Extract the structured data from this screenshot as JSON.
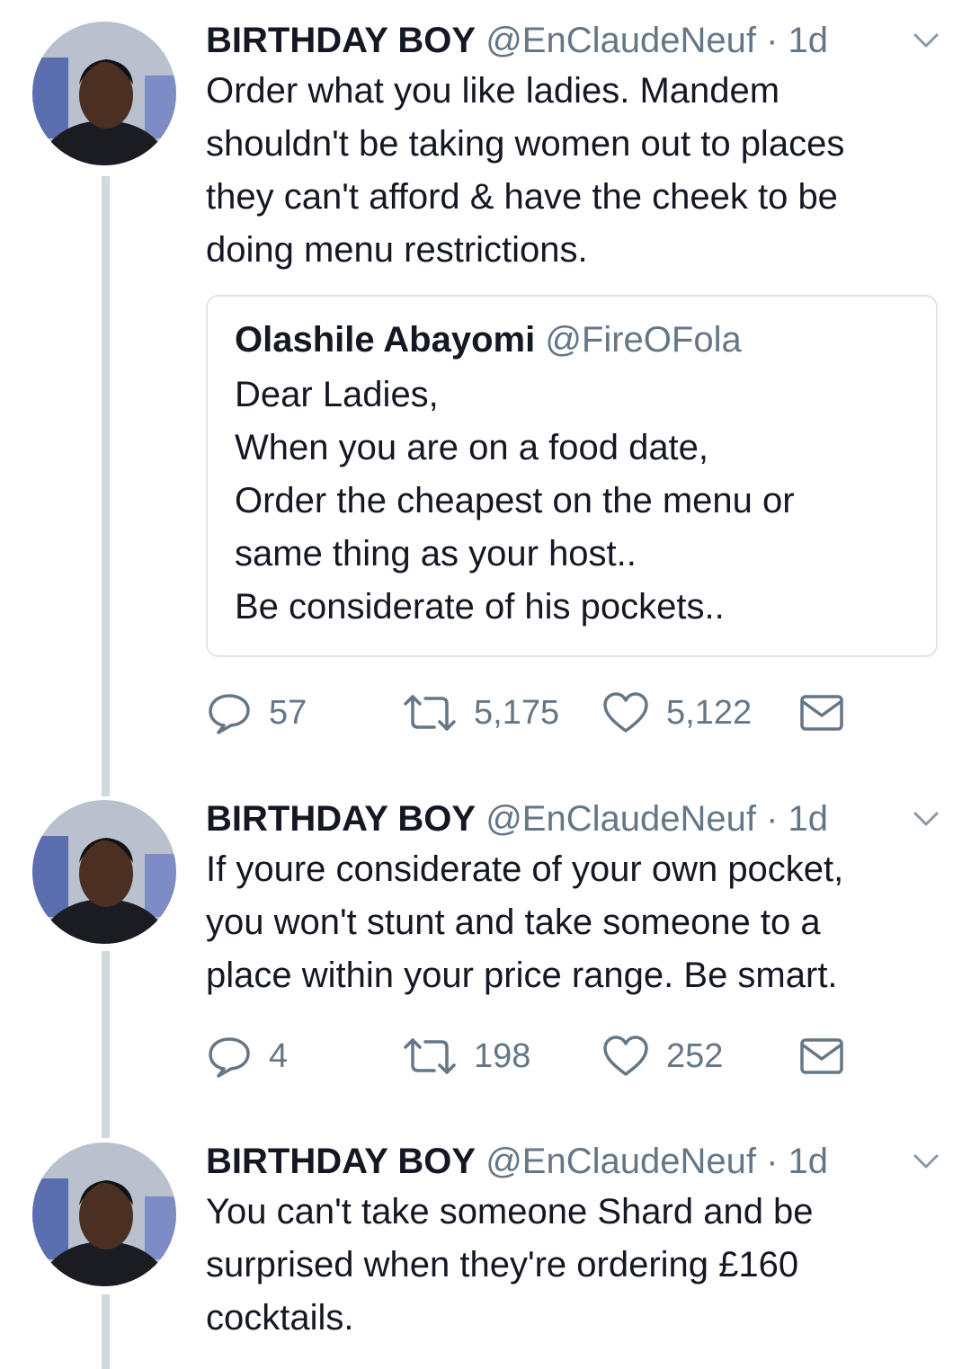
{
  "tweets": [
    {
      "name": "BIRTHDAY BOY",
      "handle": "@EnClaudeNeuf",
      "dot": "·",
      "time": "1d",
      "lines": [
        "Order what you like ladies. Mandem",
        "shouldn't be taking women out to places",
        "they can't afford & have the cheek to be",
        "doing menu restrictions."
      ],
      "quote": {
        "name": "Olashile Abayomi",
        "handle": "@FireOFola",
        "lines": [
          "Dear Ladies,",
          "When you are on a food date,",
          "Order the cheapest on the menu or",
          "same thing as your host..",
          "Be considerate of his pockets.."
        ]
      },
      "replies": "57",
      "retweets": "5,175",
      "likes": "5,122"
    },
    {
      "name": "BIRTHDAY BOY",
      "handle": "@EnClaudeNeuf",
      "dot": "·",
      "time": "1d",
      "lines": [
        "If youre considerate of your own pocket,",
        "you won't stunt and take someone to a",
        "place within your price range. Be smart."
      ],
      "replies": "4",
      "retweets": "198",
      "likes": "252"
    },
    {
      "name": "BIRTHDAY BOY",
      "handle": "@EnClaudeNeuf",
      "dot": "·",
      "time": "1d",
      "lines": [
        "You can't take someone Shard and be",
        "surprised when they're ordering £160",
        "cocktails."
      ]
    }
  ],
  "icons": {
    "reply": "reply-icon",
    "retweet": "retweet-icon",
    "like": "heart-icon",
    "dm": "envelope-icon",
    "menu": "chevron-down-icon"
  },
  "colors": {
    "text": "#141823",
    "secondary": "#657786",
    "thread_line": "#cfd9de",
    "quote_border": "#dfe6ea"
  }
}
